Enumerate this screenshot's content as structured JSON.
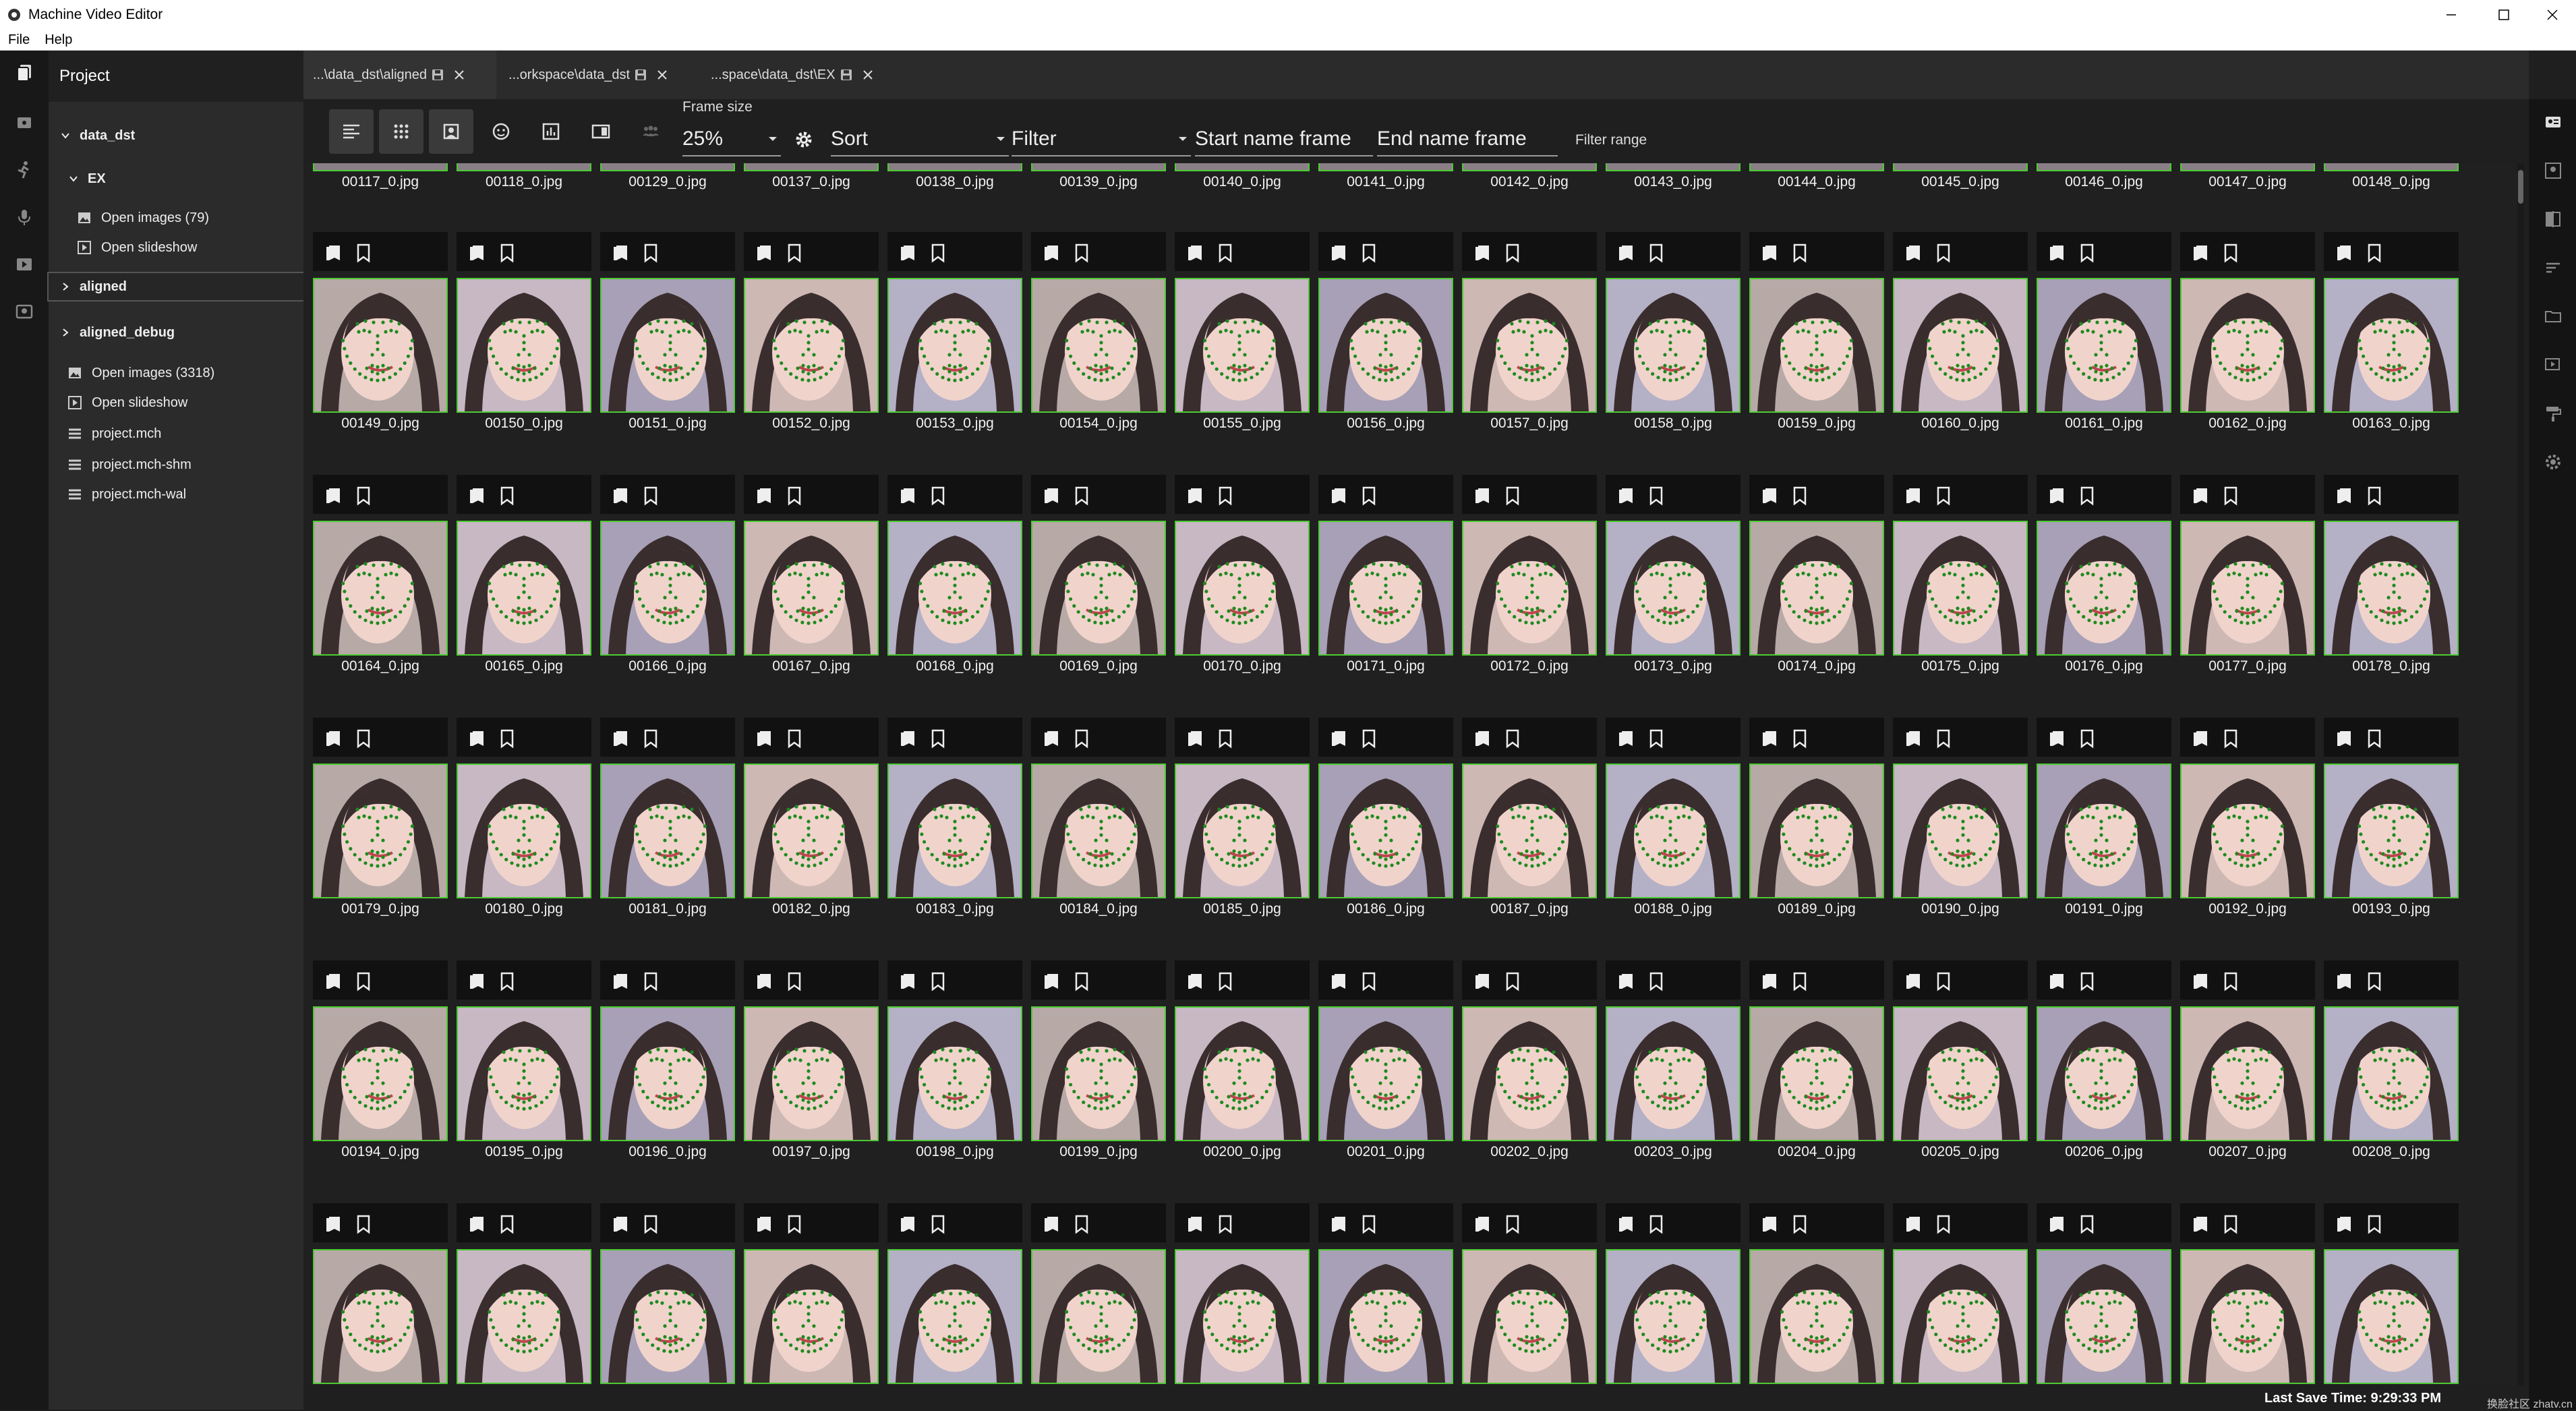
{
  "app": {
    "title": "Machine Video Editor"
  },
  "menu": {
    "items": [
      "File",
      "Help"
    ]
  },
  "sidebar": {
    "title": "Project",
    "tree": [
      {
        "label": "data_dst",
        "kind": "folder",
        "expanded": true
      },
      {
        "label": "EX",
        "kind": "folder",
        "expanded": true
      },
      {
        "label": "Open images (79)",
        "kind": "images"
      },
      {
        "label": "Open slideshow",
        "kind": "slideshow"
      },
      {
        "label": "aligned",
        "kind": "folder",
        "expanded": false,
        "selected": true
      },
      {
        "label": "aligned_debug",
        "kind": "folder",
        "expanded": false
      },
      {
        "label": "Open images (3318)",
        "kind": "images"
      },
      {
        "label": "Open slideshow",
        "kind": "slideshow"
      },
      {
        "label": "project.mch",
        "kind": "file"
      },
      {
        "label": "project.mch-shm",
        "kind": "file"
      },
      {
        "label": "project.mch-wal",
        "kind": "file"
      }
    ]
  },
  "tabs": [
    {
      "label": "...\\data_dst\\aligned",
      "active": true
    },
    {
      "label": "...orkspace\\data_dst",
      "active": false
    },
    {
      "label": "...space\\data_dst\\EX",
      "active": false
    }
  ],
  "toolbar": {
    "frame_size_label": "Frame size",
    "frame_size_value": "25%",
    "sort_label": "Sort",
    "filter_label": "Filter",
    "start_name_label": "Start name frame",
    "end_name_label": "End name frame",
    "filter_range_label": "Filter range",
    "buttons": [
      "align-left-icon",
      "grid-icon",
      "face-frame-icon",
      "face-icon",
      "chart-icon",
      "split-view-icon",
      "group-icon"
    ]
  },
  "gallery": {
    "partial_row": [
      "00117_0.jpg",
      "00118_0.jpg",
      "00129_0.jpg",
      "00137_0.jpg",
      "00138_0.jpg",
      "00139_0.jpg",
      "00140_0.jpg",
      "00141_0.jpg",
      "00142_0.jpg",
      "00143_0.jpg",
      "00144_0.jpg",
      "00145_0.jpg",
      "00146_0.jpg",
      "00147_0.jpg",
      "00148_0.jpg"
    ],
    "rows": [
      [
        "00149_0.jpg",
        "00150_0.jpg",
        "00151_0.jpg",
        "00152_0.jpg",
        "00153_0.jpg",
        "00154_0.jpg",
        "00155_0.jpg",
        "00156_0.jpg",
        "00157_0.jpg",
        "00158_0.jpg",
        "00159_0.jpg",
        "00160_0.jpg",
        "00161_0.jpg",
        "00162_0.jpg",
        "00163_0.jpg"
      ],
      [
        "00164_0.jpg",
        "00165_0.jpg",
        "00166_0.jpg",
        "00167_0.jpg",
        "00168_0.jpg",
        "00169_0.jpg",
        "00170_0.jpg",
        "00171_0.jpg",
        "00172_0.jpg",
        "00173_0.jpg",
        "00174_0.jpg",
        "00175_0.jpg",
        "00176_0.jpg",
        "00177_0.jpg",
        "00178_0.jpg"
      ],
      [
        "00179_0.jpg",
        "00180_0.jpg",
        "00181_0.jpg",
        "00182_0.jpg",
        "00183_0.jpg",
        "00184_0.jpg",
        "00185_0.jpg",
        "00186_0.jpg",
        "00187_0.jpg",
        "00188_0.jpg",
        "00189_0.jpg",
        "00190_0.jpg",
        "00191_0.jpg",
        "00192_0.jpg",
        "00193_0.jpg"
      ],
      [
        "00194_0.jpg",
        "00195_0.jpg",
        "00196_0.jpg",
        "00197_0.jpg",
        "00198_0.jpg",
        "00199_0.jpg",
        "00200_0.jpg",
        "00201_0.jpg",
        "00202_0.jpg",
        "00203_0.jpg",
        "00204_0.jpg",
        "00205_0.jpg",
        "00206_0.jpg",
        "00207_0.jpg",
        "00208_0.jpg"
      ],
      [
        "",
        "",
        "",
        "",
        "",
        "",
        "",
        "",
        "",
        "",
        "",
        "",
        "",
        "",
        ""
      ]
    ],
    "accent_color": "#4ccb32",
    "landmark_color": "#1f8a1f"
  },
  "status": {
    "last_save": "Last Save Time: 9:29:33 PM"
  },
  "watermark": "换脸社区 zhatv.cn"
}
